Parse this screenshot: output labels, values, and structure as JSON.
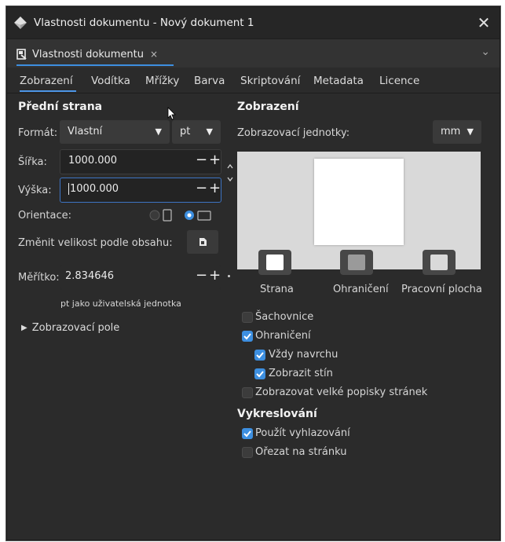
{
  "window": {
    "title": "Vlastnosti dokumentu - Nový dokument 1",
    "close_glyph": "✕"
  },
  "dock": {
    "tab_label": "Vlastnosti dokumentu",
    "tab_close": "×",
    "chevron": "⌄"
  },
  "tabs": [
    "Zobrazení",
    "Vodítka",
    "Mřížky",
    "Barva",
    "Skriptování",
    "Metadata",
    "Licence"
  ],
  "front_page": {
    "heading": "Přední strana",
    "format_label": "Formát:",
    "format_value": "Vlastní",
    "unit_value": "pt",
    "width_label": "Šířka:",
    "width_value": "1000.000",
    "height_label": "Výška:",
    "height_value": "1000.000",
    "orientation_label": "Orientace:",
    "resize_label": "Změnit velikost podle obsahu:",
    "scale_label": "Měřítko:",
    "scale_value": "2.834646",
    "scale_note": "pt jako uživatelská jednotka",
    "viewbox_label": "Zobrazovací pole",
    "minus": "−",
    "plus": "+"
  },
  "display": {
    "heading": "Zobrazení",
    "units_label": "Zobrazovací jednotky:",
    "units_value": "mm",
    "swatches": [
      {
        "label": "Strana",
        "color": "#ffffff"
      },
      {
        "label": "Ohraničení",
        "color": "#9a9a9a"
      },
      {
        "label": "Pracovní plocha",
        "color": "#d9d9d9"
      }
    ],
    "checkboxes": [
      {
        "label": "Šachovnice",
        "checked": false
      },
      {
        "label": "Ohraničení",
        "checked": true
      },
      {
        "label": "Vždy navrchu",
        "checked": true
      },
      {
        "label": "Zobrazit stín",
        "checked": true
      },
      {
        "label": "Zobrazovat velké popisky stránek",
        "checked": false
      }
    ]
  },
  "rendering": {
    "heading": "Vykreslování",
    "checkboxes": [
      {
        "label": "Použít vyhlazování",
        "checked": true
      },
      {
        "label": "Ořezat na stránku",
        "checked": false
      }
    ]
  },
  "colors": {
    "accent": "#3d8fe0",
    "window_bg": "#2b2b2b"
  }
}
